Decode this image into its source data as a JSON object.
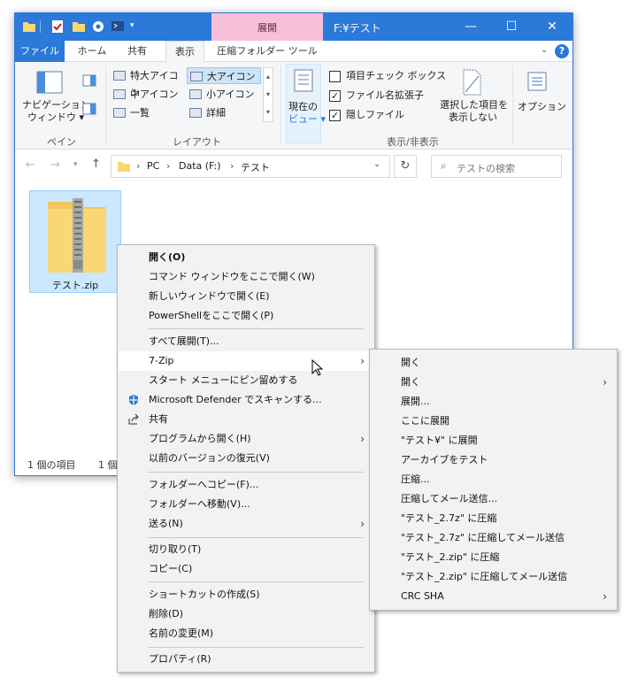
{
  "window": {
    "title": "F:¥テスト",
    "tools_tab": "展開",
    "ribbon_tabs": [
      "ファイル",
      "ホーム",
      "共有",
      "表示",
      "圧縮フォルダー ツール"
    ]
  },
  "ribbon": {
    "pane_group": {
      "nav_pane_label_1": "ナビゲーション",
      "nav_pane_label_2": "ウィンドウ ▾",
      "group": "ペイン"
    },
    "layout_group": {
      "items": [
        "特大アイコン",
        "大アイコン",
        "中アイコン",
        "小アイコン",
        "一覧",
        "詳細"
      ],
      "group": "レイアウト"
    },
    "current_view": {
      "label_1": "現在の",
      "label_2": "ビュー ▾"
    },
    "show_hide": {
      "item_check_boxes": "項目チェック ボックス",
      "file_extensions": "ファイル名拡張子",
      "hidden_files": "隠しファイル",
      "hide_selected_1": "選択した項目を",
      "hide_selected_2": "表示しない",
      "group": "表示/非表示"
    },
    "options": "オプション"
  },
  "address": {
    "path": [
      "PC",
      "Data (F:)",
      "テスト"
    ],
    "search_placeholder": "テストの検索"
  },
  "file": {
    "name": "テスト.zip"
  },
  "status": {
    "count": "1 個の項目",
    "count_partial": "1 個の"
  },
  "context_menu": {
    "open": "開く(O)",
    "cmd_here": "コマンド ウィンドウをここで開く(W)",
    "new_window": "新しいウィンドウで開く(E)",
    "powershell": "PowerShellをここで開く(P)",
    "extract_all": "すべて展開(T)...",
    "seven_zip": "7-Zip",
    "pin_start": "スタート メニューにピン留めする",
    "defender": "Microsoft Defender でスキャンする...",
    "share": "共有",
    "open_with": "プログラムから開く(H)",
    "restore_prev": "以前のバージョンの復元(V)",
    "copy_to": "フォルダーへコピー(F)...",
    "move_to": "フォルダーへ移動(V)...",
    "send_to": "送る(N)",
    "cut": "切り取り(T)",
    "copy": "コピー(C)",
    "create_shortcut": "ショートカットの作成(S)",
    "delete": "削除(D)",
    "rename": "名前の変更(M)",
    "properties": "プロパティ(R)"
  },
  "sevenzip_menu": [
    "開く",
    "開く",
    "展開...",
    "ここに展開",
    "\"テスト¥\" に展開",
    "アーカイブをテスト",
    "圧縮...",
    "圧縮してメール送信...",
    "\"テスト_2.7z\" に圧縮",
    "\"テスト_2.7z\" に圧縮してメール送信",
    "\"テスト_2.zip\" に圧縮",
    "\"テスト_2.zip\" に圧縮してメール送信",
    "CRC SHA"
  ],
  "colors": {
    "titlebar": "#2b79d8",
    "tools_tab": "#f8bfd9",
    "selection": "#cce8ff",
    "menu_bg": "#f2f2f2"
  }
}
